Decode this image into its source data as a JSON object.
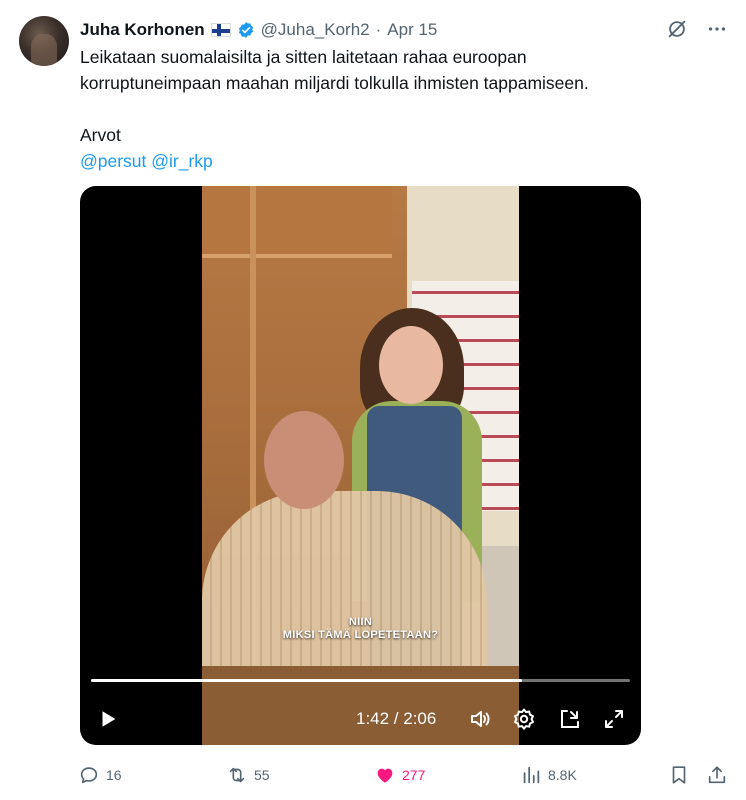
{
  "author": {
    "name": "Juha Korhonen",
    "handle": "@Juha_Korh2",
    "separator": "·",
    "date": "Apr 15"
  },
  "tweet": {
    "line1": "Leikataan suomalaisilta ja sitten laitetaan rahaa euroopan",
    "line2": "korruptuneimpaan maahan miljardi tolkulla ihmisten tappamiseen.",
    "line3": "Arvot",
    "mentions": "@persut @ir_rkp"
  },
  "video": {
    "subtitle_line1": "NIIN",
    "subtitle_line2": "MIKSI TÄMÄ LOPETETAAN?",
    "time": "1:42 / 2:06",
    "progress": 0.8
  },
  "actions": {
    "replies": "16",
    "reposts": "55",
    "likes": "277",
    "views": "8.8K"
  },
  "colors": {
    "accent": "#1d9bf0",
    "like": "#f91880",
    "muted": "#536471",
    "flag_blue": "#1d3f8f"
  },
  "icons": [
    "verified-badge-icon",
    "grok-icon",
    "more-icon",
    "play-icon",
    "volume-icon",
    "settings-icon",
    "pip-icon",
    "fullscreen-icon",
    "reply-icon",
    "repost-icon",
    "like-icon",
    "views-icon",
    "bookmark-icon",
    "share-icon"
  ]
}
